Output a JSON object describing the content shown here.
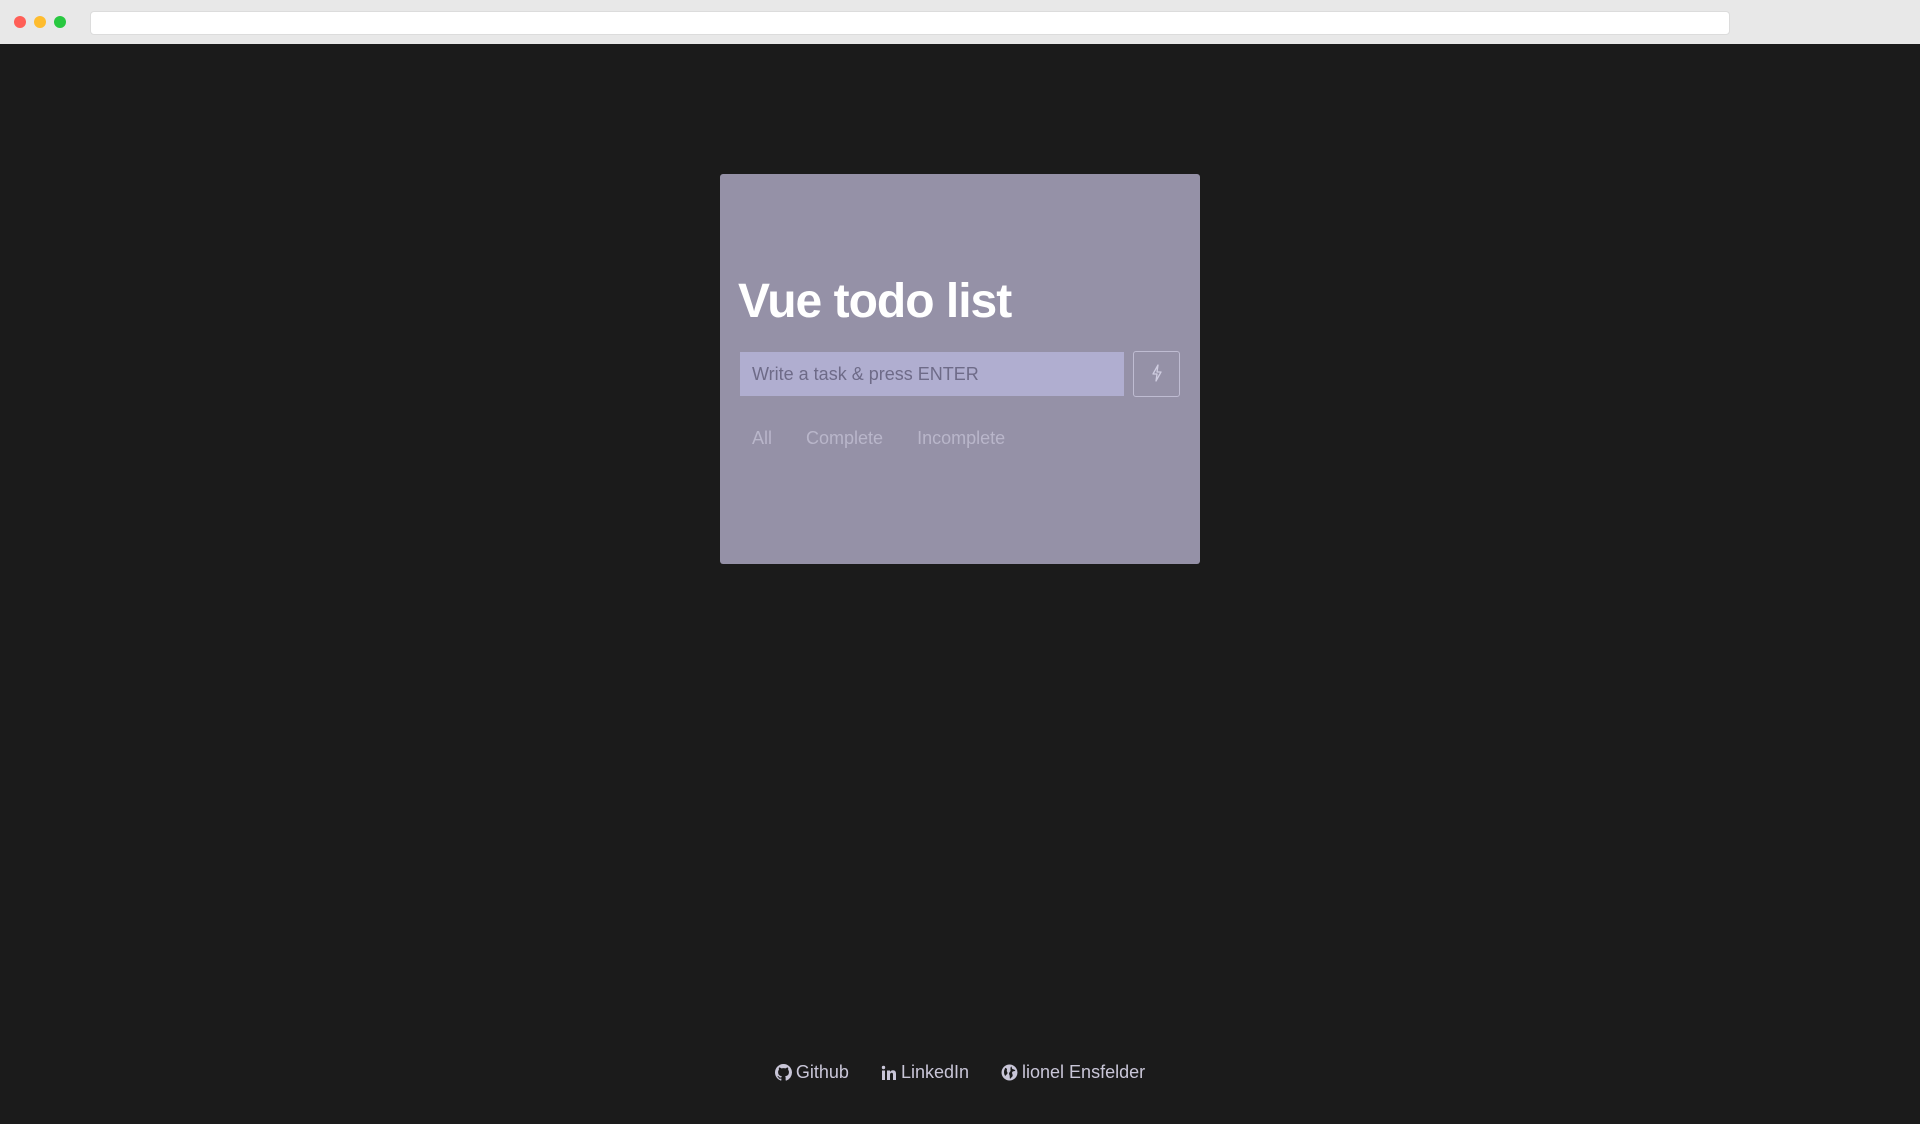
{
  "window": {
    "traffic_lights": [
      "close",
      "minimize",
      "zoom"
    ],
    "address": ""
  },
  "app": {
    "title": "Vue todo list",
    "input": {
      "placeholder": "Write a task & press ENTER",
      "value": ""
    },
    "submit_icon": "lightning-bolt-icon",
    "filters": [
      {
        "label": "All"
      },
      {
        "label": "Complete"
      },
      {
        "label": "Incomplete"
      }
    ]
  },
  "footer": {
    "links": [
      {
        "label": "Github",
        "icon": "github-icon"
      },
      {
        "label": "LinkedIn",
        "icon": "linkedin-icon"
      },
      {
        "label": "lionel Ensfelder",
        "icon": "globe-icon"
      }
    ]
  },
  "colors": {
    "background": "#1b1b1b",
    "card": "#9591a7",
    "input": "#b0aed0",
    "title": "#ffffff",
    "filter_text": "#b9b6ca",
    "footer_text": "#c9c6d8"
  }
}
